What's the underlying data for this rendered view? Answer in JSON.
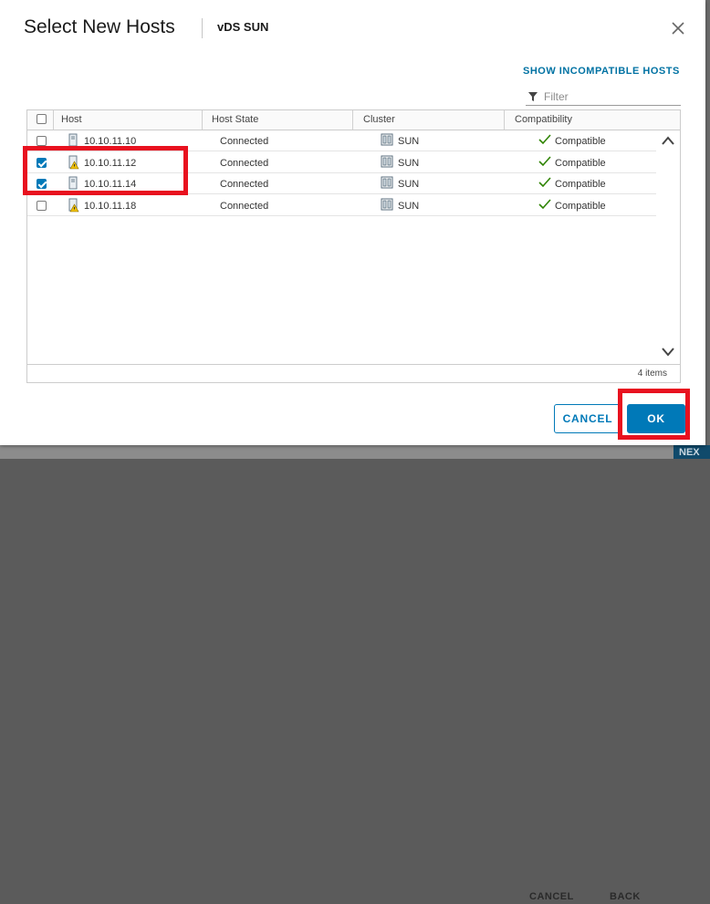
{
  "dialog": {
    "title": "Select New Hosts",
    "subtitle": "vDS SUN",
    "show_incompatible_label": "SHOW INCOMPATIBLE HOSTS",
    "filter_placeholder": "Filter"
  },
  "grid": {
    "columns": [
      "Host",
      "Host State",
      "Cluster",
      "Compatibility"
    ],
    "rows": [
      {
        "host": "10.10.11.10",
        "state": "Connected",
        "cluster": "SUN",
        "compatibility": "Compatible",
        "checked": false,
        "warning": false
      },
      {
        "host": "10.10.11.12",
        "state": "Connected",
        "cluster": "SUN",
        "compatibility": "Compatible",
        "checked": true,
        "warning": true
      },
      {
        "host": "10.10.11.14",
        "state": "Connected",
        "cluster": "SUN",
        "compatibility": "Compatible",
        "checked": true,
        "warning": false
      },
      {
        "host": "10.10.11.18",
        "state": "Connected",
        "cluster": "SUN",
        "compatibility": "Compatible",
        "checked": false,
        "warning": true
      }
    ],
    "footer_count": "4 items"
  },
  "buttons": {
    "cancel": "CANCEL",
    "ok": "OK"
  },
  "background_buttons": {
    "cancel": "CANCEL",
    "back": "BACK",
    "next": "NEX"
  },
  "colors": {
    "accent": "#0079b8",
    "link": "#0072a3",
    "success": "#2f8400",
    "warning": "#efc006",
    "highlight": "#e8111f"
  },
  "icons": {
    "host": "host-server-icon",
    "host_warning": "host-warning-icon",
    "cluster": "cluster-icon",
    "compatible": "checkmark-icon",
    "filter": "filter-icon",
    "close": "close-icon"
  }
}
